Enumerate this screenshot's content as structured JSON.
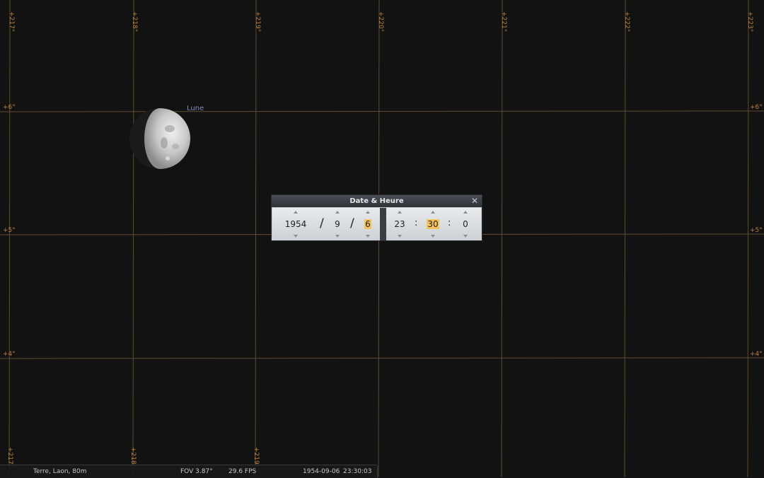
{
  "sky": {
    "grid_color": "#8a6a45",
    "ra_labels_top": [
      "+217°",
      "+218°",
      "+219°",
      "+220°",
      "+221°",
      "+222°",
      "+223°"
    ],
    "ra_labels_bottom": [
      "+217°",
      "+218°",
      "+219°"
    ],
    "dec_labels_left": [
      "+6°",
      "+5°",
      "+4°"
    ],
    "dec_labels_right": [
      "+6°",
      "+5°",
      "+4°"
    ],
    "moon_label": "Lune"
  },
  "dialog": {
    "title": "Date & Heure",
    "year": "1954",
    "month": "9",
    "day": "6",
    "hour": "23",
    "minute": "30",
    "second": "0",
    "date_sep": "/",
    "time_sep": ":",
    "highlight_color": "#f3c25c"
  },
  "statusbar": {
    "location": "Terre, Laon, 80m",
    "fov": "FOV 3.87°",
    "fps": "29.6 FPS",
    "date": "1954-09-06",
    "time": "23:30:03"
  }
}
